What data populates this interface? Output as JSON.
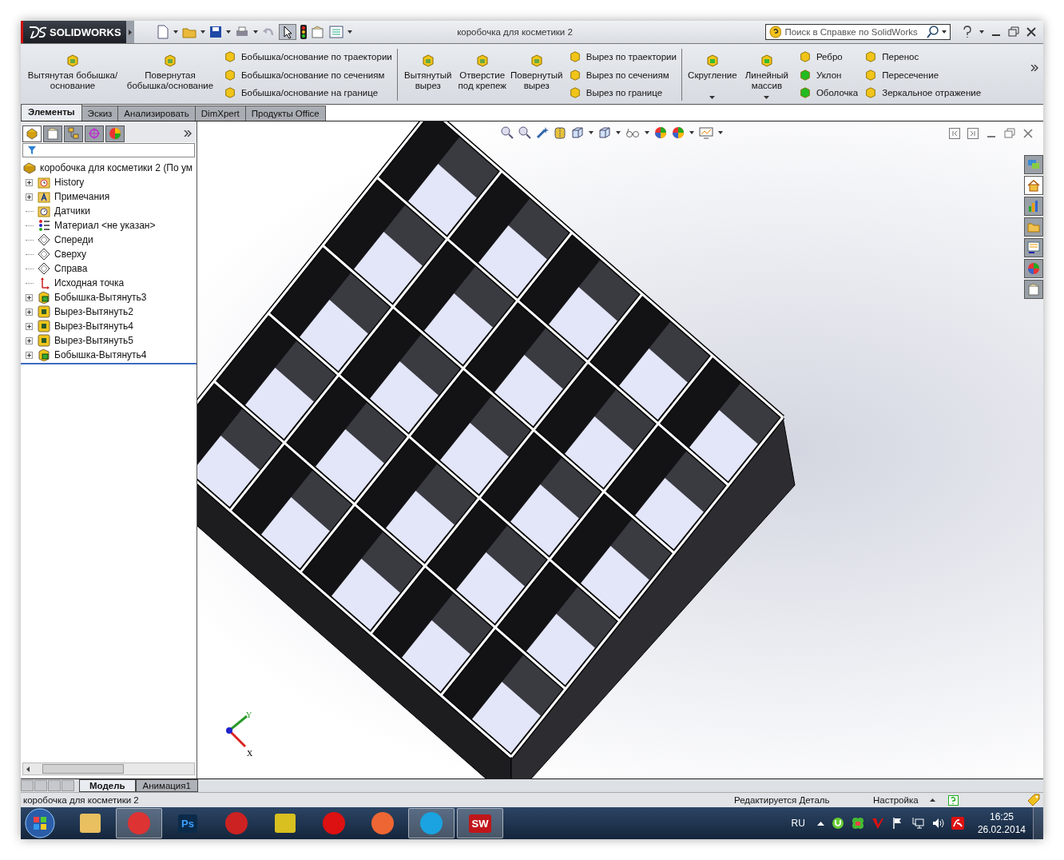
{
  "window": {
    "logo": "SOLIDWORKS",
    "title": "коробочка для косметики 2"
  },
  "search": {
    "placeholder": "Поиск в Справке по SolidWorks"
  },
  "ribbon": {
    "groups": [
      {
        "large": [
          {
            "label": "Вытянутая бобышка/основание",
            "dropdown": false
          },
          {
            "label": "Повернутая бобышка/основание",
            "dropdown": false
          }
        ],
        "columns": [
          [
            "Бобышка/основание по траектории",
            "Бобышка/основание по сечениям",
            "Бобышка/основание на границе"
          ]
        ]
      },
      {
        "large": [
          {
            "label": "Вытянутый вырез",
            "dropdown": false
          },
          {
            "label": "Отверстие под крепеж",
            "dropdown": false
          },
          {
            "label": "Повернутый вырез",
            "dropdown": false
          }
        ],
        "columns": [
          [
            "Вырез по траектории",
            "Вырез по сечениям",
            "Вырез по границе"
          ]
        ]
      },
      {
        "large": [
          {
            "label": "Скругление",
            "dropdown": true
          },
          {
            "label": "Линейный массив",
            "dropdown": true
          }
        ],
        "columns": [
          [
            "Ребро",
            "Уклон",
            "Оболочка"
          ],
          [
            "Перенос",
            "Пересечение",
            "Зеркальное отражение"
          ]
        ]
      }
    ]
  },
  "tabs": [
    {
      "label": "Элементы",
      "selected": true
    },
    {
      "label": "Эскиз",
      "selected": false
    },
    {
      "label": "Анализировать",
      "selected": false
    },
    {
      "label": "DimXpert",
      "selected": false
    },
    {
      "label": "Продукты Office",
      "selected": false
    }
  ],
  "panel_tabs": [
    {
      "selected": true
    },
    {
      "selected": false
    },
    {
      "selected": false
    },
    {
      "selected": false
    },
    {
      "selected": false
    }
  ],
  "tree": {
    "root": "коробочка для косметики 2  (По ум",
    "items": [
      {
        "label": "History",
        "kind": "history",
        "expandable": true
      },
      {
        "label": "Примечания",
        "kind": "notes",
        "expandable": true
      },
      {
        "label": "Датчики",
        "kind": "sensors",
        "expandable": false
      },
      {
        "label": "Материал <не указан>",
        "kind": "material",
        "expandable": false
      },
      {
        "label": "Спереди",
        "kind": "plane",
        "expandable": false
      },
      {
        "label": "Сверху",
        "kind": "plane",
        "expandable": false
      },
      {
        "label": "Справа",
        "kind": "plane",
        "expandable": false
      },
      {
        "label": "Исходная точка",
        "kind": "origin",
        "expandable": false
      },
      {
        "label": "Бобышка-Вытянуть3",
        "kind": "boss",
        "expandable": true
      },
      {
        "label": "Вырез-Вытянуть2",
        "kind": "cut",
        "expandable": true
      },
      {
        "label": "Вырез-Вытянуть4",
        "kind": "cut",
        "expandable": true
      },
      {
        "label": "Вырез-Вытянуть5",
        "kind": "cut",
        "expandable": true
      },
      {
        "label": "Бобышка-Вытянуть4",
        "kind": "boss",
        "expandable": true
      }
    ]
  },
  "triad": {
    "x": "X",
    "y": "Y"
  },
  "bottom_tabs": [
    {
      "label": "Модель",
      "selected": true
    },
    {
      "label": "Анимация1",
      "selected": false
    }
  ],
  "status_bar": {
    "document": "коробочка для косметики 2",
    "mode": "Редактируется Деталь",
    "units": "Настройка"
  },
  "taskbar": {
    "apps": [
      {
        "kind": "explorer",
        "running": false
      },
      {
        "kind": "chrome",
        "running": true
      },
      {
        "kind": "photoshop",
        "label": "Ps",
        "running": false
      },
      {
        "kind": "flame",
        "running": false
      },
      {
        "kind": "qip",
        "running": false
      },
      {
        "kind": "opera",
        "running": false
      },
      {
        "kind": "pinwheel",
        "running": false
      },
      {
        "kind": "skype",
        "running": true
      },
      {
        "kind": "solidworks",
        "label": "SW",
        "running": true
      }
    ],
    "language": "RU",
    "time": "16:25",
    "date": "26.02.2014"
  }
}
